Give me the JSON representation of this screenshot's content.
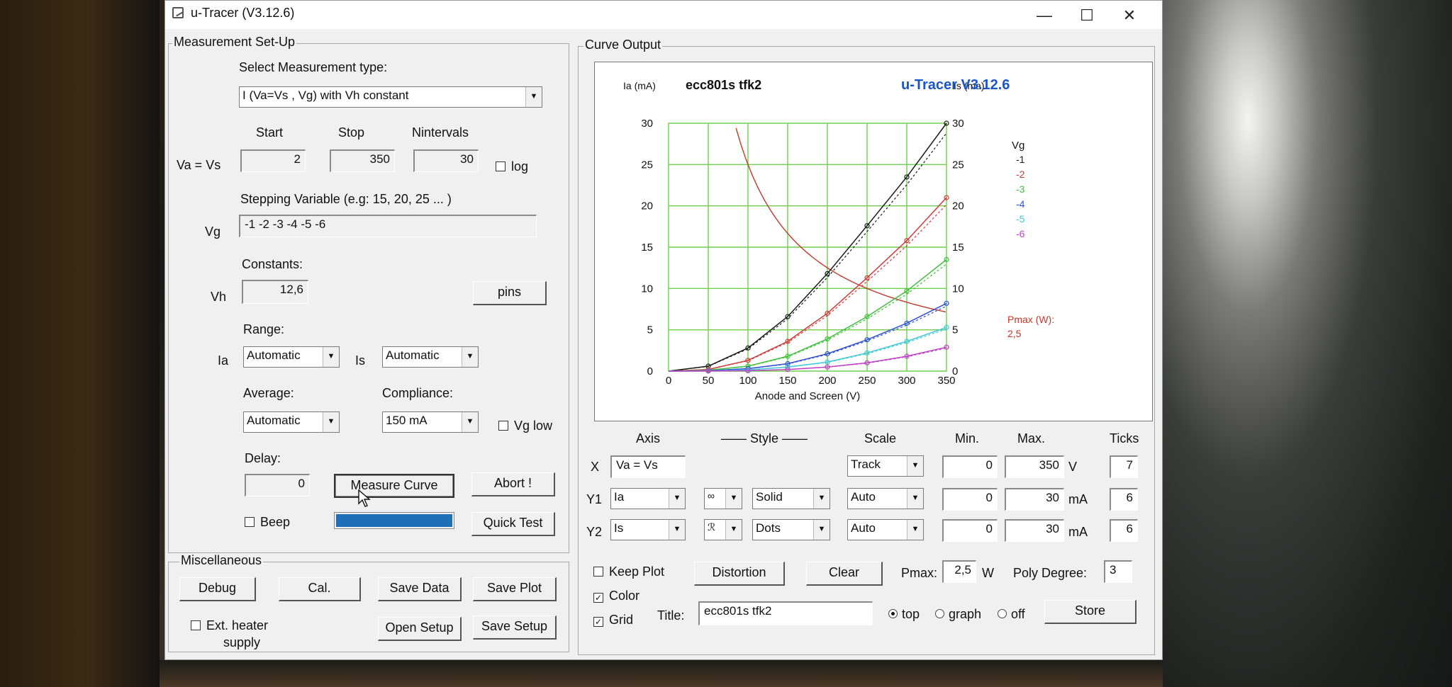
{
  "window": {
    "title": "u-Tracer (V3.12.6)",
    "min_glyph": "—",
    "max_glyph": "☐",
    "close_glyph": "✕"
  },
  "setup": {
    "group_label": "Measurement Set-Up",
    "select_type_label": "Select Measurement type:",
    "measurement_type": "I (Va=Vs , Vg) with Vh constant",
    "start_label": "Start",
    "stop_label": "Stop",
    "nintervals_label": "Nintervals",
    "va_label": "Va = Vs",
    "start": "2",
    "stop": "350",
    "nintervals": "30",
    "log_label": "log",
    "stepping_label": "Stepping Variable (e.g: 15, 20, 25 ... )",
    "vg_label": "Vg",
    "vg_steps": "-1 -2 -3 -4 -5 -6",
    "constants_label": "Constants:",
    "vh_label": "Vh",
    "vh": "12,6",
    "pins_label": "pins",
    "range_label": "Range:",
    "ia_label": "Ia",
    "ia_range": "Automatic",
    "is_label": "Is",
    "is_range": "Automatic",
    "average_label": "Average:",
    "average": "Automatic",
    "compliance_label": "Compliance:",
    "compliance": "150 mA",
    "vglow_label": "Vg low",
    "delay_label": "Delay:",
    "delay": "0",
    "measure_label": "Measure Curve",
    "abort_label": "Abort !",
    "beep_label": "Beep",
    "progress": 1.0,
    "quicktest_label": "Quick Test"
  },
  "misc": {
    "group_label": "Miscellaneous",
    "debug_label": "Debug",
    "cal_label": "Cal.",
    "savedata_label": "Save Data",
    "saveplot_label": "Save Plot",
    "extheater_line1": "Ext. heater",
    "extheater_line2": "supply",
    "opensetup_label": "Open Setup",
    "savesetup_label": "Save Setup"
  },
  "curve": {
    "group_label": "Curve Output",
    "axis_header": "Axis",
    "style_header": "—— Style ——",
    "scale_header": "Scale",
    "min_header": "Min.",
    "max_header": "Max.",
    "ticks_header": "Ticks",
    "x_label": "X",
    "x_var": "Va = Vs",
    "x_scale": "Track",
    "x_min": "0",
    "x_max": "350",
    "x_unit": "V",
    "x_ticks": "7",
    "y1_label": "Y1",
    "y1_var": "Ia",
    "y1_line": "Solid",
    "y1_scale": "Auto",
    "y1_min": "0",
    "y1_max": "30",
    "y1_unit": "mA",
    "y1_ticks": "6",
    "y2_label": "Y2",
    "y2_var": "Is",
    "y2_line": "Dots",
    "y2_scale": "Auto",
    "y2_min": "0",
    "y2_max": "30",
    "y2_unit": "mA",
    "y2_ticks": "6",
    "keepplot_label": "Keep Plot",
    "distortion_label": "Distortion",
    "clear_label": "Clear",
    "pmax_label": "Pmax:",
    "pmax_value": "2,5",
    "pmax_unit": "W",
    "polydeg_label": "Poly Degree:",
    "polydeg_value": "3",
    "color_label": "Color",
    "grid_label": "Grid",
    "title_label": "Title:",
    "title_value": "ecc801s tfk2",
    "radio_top": "top",
    "radio_graph": "graph",
    "radio_off": "off",
    "store_label": "Store",
    "check_mark": "✓"
  },
  "chart_data": {
    "type": "line",
    "title": "ecc801s tfk2",
    "brand": "u-Tracer V3.12.6",
    "xlabel": "Anode and Screen (V)",
    "ylabel": "Ia (mA)",
    "y2label": "Is (ma)",
    "xlim": [
      0,
      350
    ],
    "ylim": [
      0,
      30
    ],
    "xticks": [
      0,
      50,
      100,
      150,
      200,
      250,
      300,
      350
    ],
    "yticks": [
      0,
      5,
      10,
      15,
      20,
      25,
      30
    ],
    "grid": true,
    "legend_title": "Vg",
    "legend_position": "right",
    "pmax_label": "Pmax (W):",
    "pmax_value": "2,5",
    "pmax_watts": 2.5,
    "x": [
      0,
      50,
      100,
      150,
      200,
      250,
      300,
      350
    ],
    "series": [
      {
        "name": "-1",
        "color": "#1a1a1a",
        "values": [
          0,
          0.6,
          2.8,
          6.6,
          11.8,
          17.6,
          23.5,
          30
        ]
      },
      {
        "name": "-2",
        "color": "#d03a3a",
        "values": [
          0,
          0.2,
          1.3,
          3.6,
          7.0,
          11.3,
          15.8,
          21
        ]
      },
      {
        "name": "-3",
        "color": "#3fbf3a",
        "values": [
          0,
          0.1,
          0.6,
          1.8,
          3.9,
          6.6,
          9.7,
          13.5
        ]
      },
      {
        "name": "-4",
        "color": "#2f4fd0",
        "values": [
          0,
          0.05,
          0.3,
          0.9,
          2.1,
          3.8,
          5.8,
          8.2
        ]
      },
      {
        "name": "-5",
        "color": "#3fc8d8",
        "values": [
          0,
          0.02,
          0.15,
          0.5,
          1.1,
          2.2,
          3.6,
          5.3
        ]
      },
      {
        "name": "-6",
        "color": "#c040c8",
        "values": [
          0,
          0.01,
          0.05,
          0.2,
          0.5,
          1.0,
          1.8,
          2.9
        ]
      }
    ],
    "pmax_color": "#c0392b"
  }
}
